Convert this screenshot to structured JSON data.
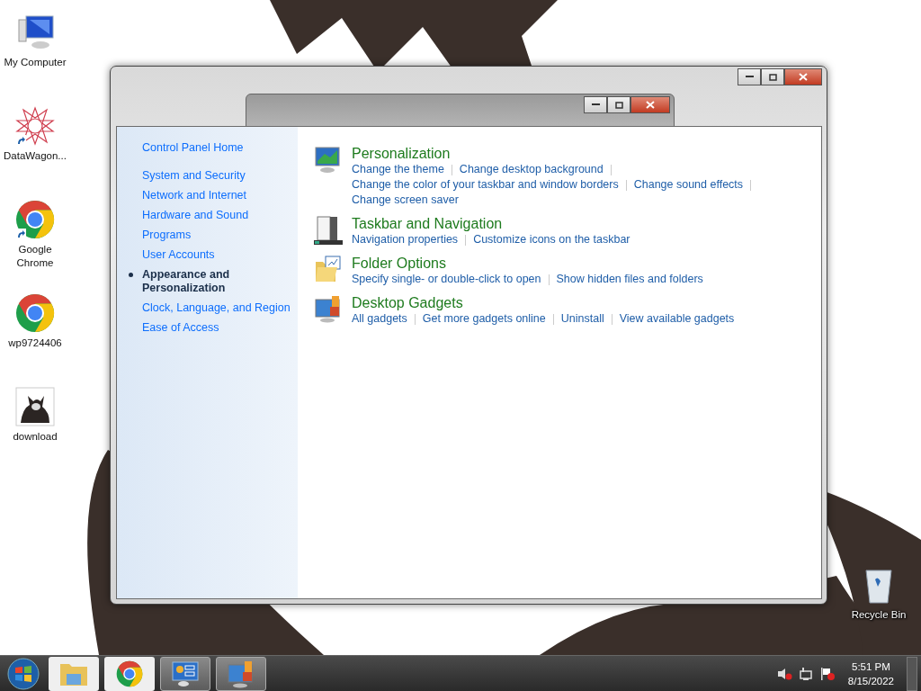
{
  "desktop_icons": [
    {
      "label": "My Computer",
      "kind": "computer",
      "shortcut": false
    },
    {
      "label": "DataWagon...",
      "kind": "star",
      "shortcut": true
    },
    {
      "label": "Google Chrome",
      "kind": "chrome",
      "shortcut": true
    },
    {
      "label": "wp9724406",
      "kind": "chrome",
      "shortcut": false
    },
    {
      "label": "download",
      "kind": "image",
      "shortcut": false
    }
  ],
  "recycle_bin": {
    "label": "Recycle Bin"
  },
  "sidebar": {
    "home": "Control Panel Home",
    "items": [
      {
        "label": "System and Security",
        "selected": false
      },
      {
        "label": "Network and Internet",
        "selected": false
      },
      {
        "label": "Hardware and Sound",
        "selected": false
      },
      {
        "label": "Programs",
        "selected": false
      },
      {
        "label": "User Accounts",
        "selected": false
      },
      {
        "label": "Appearance and Personalization",
        "selected": true
      },
      {
        "label": "Clock, Language, and Region",
        "selected": false
      },
      {
        "label": "Ease of Access",
        "selected": false
      }
    ]
  },
  "categories": [
    {
      "title": "Personalization",
      "kind": "monitor",
      "lines": [
        [
          "Change the theme",
          "Change desktop background"
        ],
        [
          "Change the color of your taskbar and window borders",
          "Change sound effects"
        ],
        [
          "Change screen saver"
        ]
      ]
    },
    {
      "title": "Taskbar and Navigation",
      "kind": "taskbar",
      "lines": [
        [
          "Navigation properties",
          "Customize icons on the taskbar"
        ]
      ]
    },
    {
      "title": "Folder Options",
      "kind": "folder",
      "lines": [
        [
          "Specify single- or double-click to open",
          "Show hidden files and folders"
        ]
      ]
    },
    {
      "title": "Desktop Gadgets",
      "kind": "gadgets",
      "lines": [
        [
          "All gadgets",
          "Get more gadgets online",
          "Uninstall",
          "View available gadgets"
        ]
      ]
    }
  ],
  "taskbar": {
    "items": [
      {
        "kind": "folder",
        "active": false
      },
      {
        "kind": "chrome",
        "active": false
      },
      {
        "kind": "control",
        "active": true
      },
      {
        "kind": "monitor",
        "active": true
      }
    ],
    "time": "5:51 PM",
    "date": "8/15/2022"
  }
}
